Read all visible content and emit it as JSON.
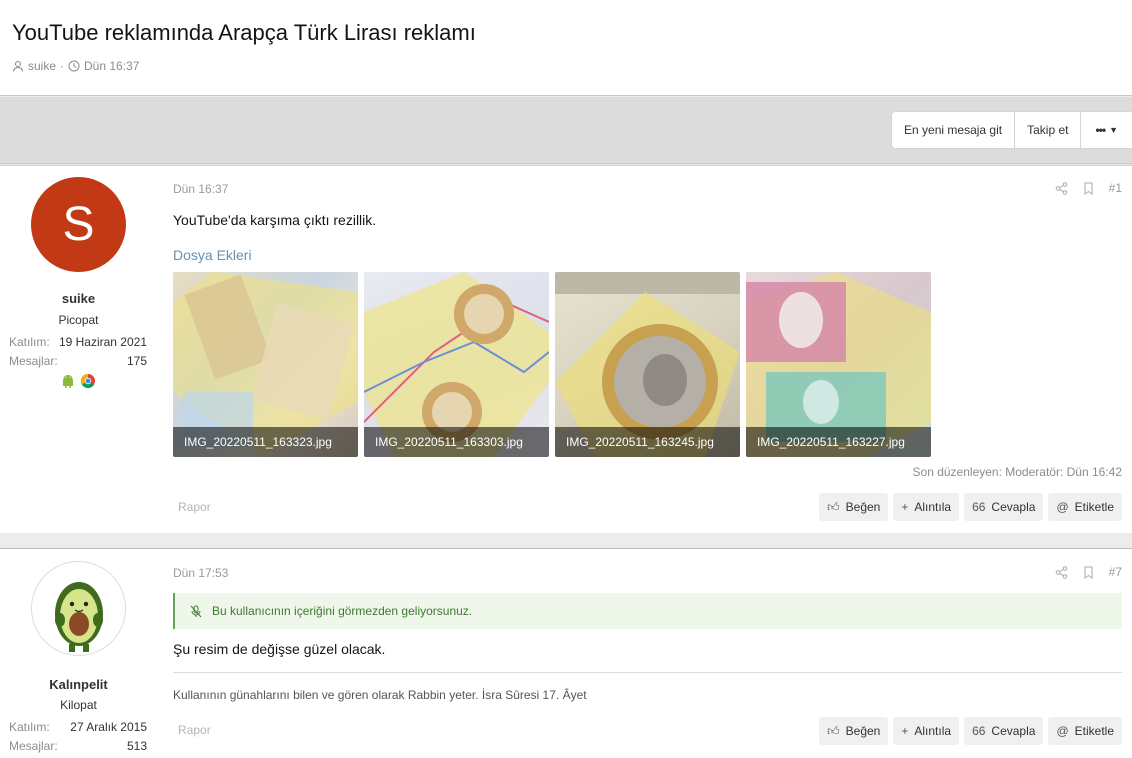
{
  "thread": {
    "title": "YouTube reklamında Arapça Türk Lirası reklamı",
    "author": "suike",
    "date": "Dün 16:37"
  },
  "toolbar": {
    "latest_label": "En yeni mesaja git",
    "follow_label": "Takip et",
    "more_label": "•••"
  },
  "posts": [
    {
      "user": {
        "avatar_letter": "S",
        "name": "suike",
        "title": "Picopat",
        "joined_label": "Katılım:",
        "joined_value": "19 Haziran 2021",
        "messages_label": "Mesajlar:",
        "messages_value": "175",
        "icons": [
          "android-icon",
          "chrome-icon"
        ]
      },
      "date": "Dün 16:37",
      "number": "#1",
      "text": "YouTube'da karşıma çıktı rezillik.",
      "attachments_title": "Dosya Ekleri",
      "attachments": [
        "IMG_20220511_163323.jpg",
        "IMG_20220511_163303.jpg",
        "IMG_20220511_163245.jpg",
        "IMG_20220511_163227.jpg"
      ],
      "edited": "Son düzenleyen: Moderatör: Dün 16:42",
      "report": "Rapor",
      "actions": {
        "like": "Beğen",
        "quote": "Alıntıla",
        "reply": "Cevapla",
        "tag": "Etiketle"
      }
    },
    {
      "user": {
        "name": "Kalınpelit",
        "title": "Kilopat",
        "joined_label": "Katılım:",
        "joined_value": "27 Aralık 2015",
        "messages_label": "Mesajlar:",
        "messages_value": "513"
      },
      "date": "Dün 17:53",
      "number": "#7",
      "ignore_notice": "Bu kullanıcının içeriğini görmezden geliyorsunuz.",
      "text": "Şu resim de değişse güzel olacak.",
      "signature": "Kullanının günahlarını bilen ve gören olarak Rabbin yeter. İsra Sûresi 17. Âyet",
      "report": "Rapor",
      "actions": {
        "like": "Beğen",
        "quote": "Alıntıla",
        "reply": "Cevapla",
        "tag": "Etiketle"
      }
    }
  ],
  "colors": {
    "avatar_bg": "#c13a15",
    "attachment_title": "#6b8fae",
    "ignore_bg": "#eef7ea",
    "ignore_text": "#3d7a2e"
  }
}
